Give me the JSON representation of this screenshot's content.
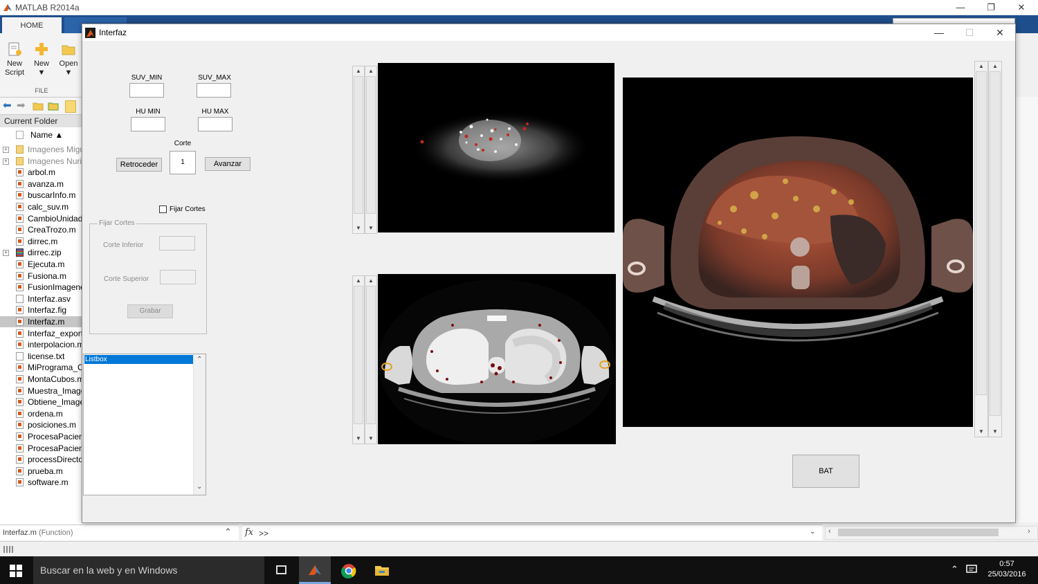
{
  "matlab": {
    "title": "MATLAB R2014a",
    "home_tab": "HOME",
    "ribbon": {
      "new_script": [
        "New",
        "Script"
      ],
      "new": "New",
      "open": "Open",
      "section": "FILE"
    },
    "current_folder": {
      "header": "Current Folder",
      "column_name": "Name ▲",
      "items": [
        {
          "name": "Imagenes Migu",
          "type": "folder"
        },
        {
          "name": "Imagenes Nuria",
          "type": "folder"
        },
        {
          "name": "arbol.m",
          "type": "m"
        },
        {
          "name": "avanza.m",
          "type": "m"
        },
        {
          "name": "buscarInfo.m",
          "type": "m"
        },
        {
          "name": "calc_suv.m",
          "type": "m"
        },
        {
          "name": "CambioUnidad",
          "type": "m"
        },
        {
          "name": "CreaTrozo.m",
          "type": "m"
        },
        {
          "name": "dirrec.m",
          "type": "m"
        },
        {
          "name": "dirrec.zip",
          "type": "zip"
        },
        {
          "name": "Ejecuta.m",
          "type": "m"
        },
        {
          "name": "Fusiona.m",
          "type": "m"
        },
        {
          "name": "FusionImagene",
          "type": "m"
        },
        {
          "name": "Interfaz.asv",
          "type": "file"
        },
        {
          "name": "Interfaz.fig",
          "type": "m"
        },
        {
          "name": "Interfaz.m",
          "type": "m",
          "selected": true
        },
        {
          "name": "Interfaz_export.",
          "type": "m"
        },
        {
          "name": "interpolacion.m",
          "type": "m"
        },
        {
          "name": "license.txt",
          "type": "file"
        },
        {
          "name": "MiPrograma_O",
          "type": "m"
        },
        {
          "name": "MontaCubos.m",
          "type": "m"
        },
        {
          "name": "Muestra_Image",
          "type": "m"
        },
        {
          "name": "Obtiene_Image",
          "type": "m"
        },
        {
          "name": "ordena.m",
          "type": "m"
        },
        {
          "name": "posiciones.m",
          "type": "m"
        },
        {
          "name": "ProcesaPacient",
          "type": "m"
        },
        {
          "name": "ProcesaPacient",
          "type": "m"
        },
        {
          "name": "processDirector",
          "type": "m"
        },
        {
          "name": "prueba.m",
          "type": "m"
        },
        {
          "name": "software.m",
          "type": "m"
        }
      ]
    },
    "details": {
      "name": "Interfaz.m",
      "kind": "(Function)"
    },
    "command_window": {
      "prompt": ">>"
    }
  },
  "figure": {
    "title": "Interfaz",
    "suv_min_label": "SUV_MIN",
    "suv_max_label": "SUV_MAX",
    "hu_min_label": "HU MIN",
    "hu_max_label": "HU MAX",
    "corte_label": "Corte",
    "corte_value": "1",
    "retroceder": "Retroceder",
    "avanzar": "Avanzar",
    "fijar_cortes_checkbox": "Fijar Cortes",
    "panel": {
      "title": "Fijar Cortes",
      "corte_inferior": "Corte Inferior",
      "corte_superior": "Corte Superior",
      "grabar": "Grabar"
    },
    "listbox": {
      "selected": "Listbox"
    },
    "bat_button": "BAT"
  },
  "taskbar": {
    "search_placeholder": "Buscar en la web y en Windows",
    "time": "0:57",
    "date": "25/03/2016"
  },
  "colors": {
    "ribbon_blue": "#1f4e8c",
    "selection_blue": "#0078d7",
    "taskbar": "#101010"
  }
}
